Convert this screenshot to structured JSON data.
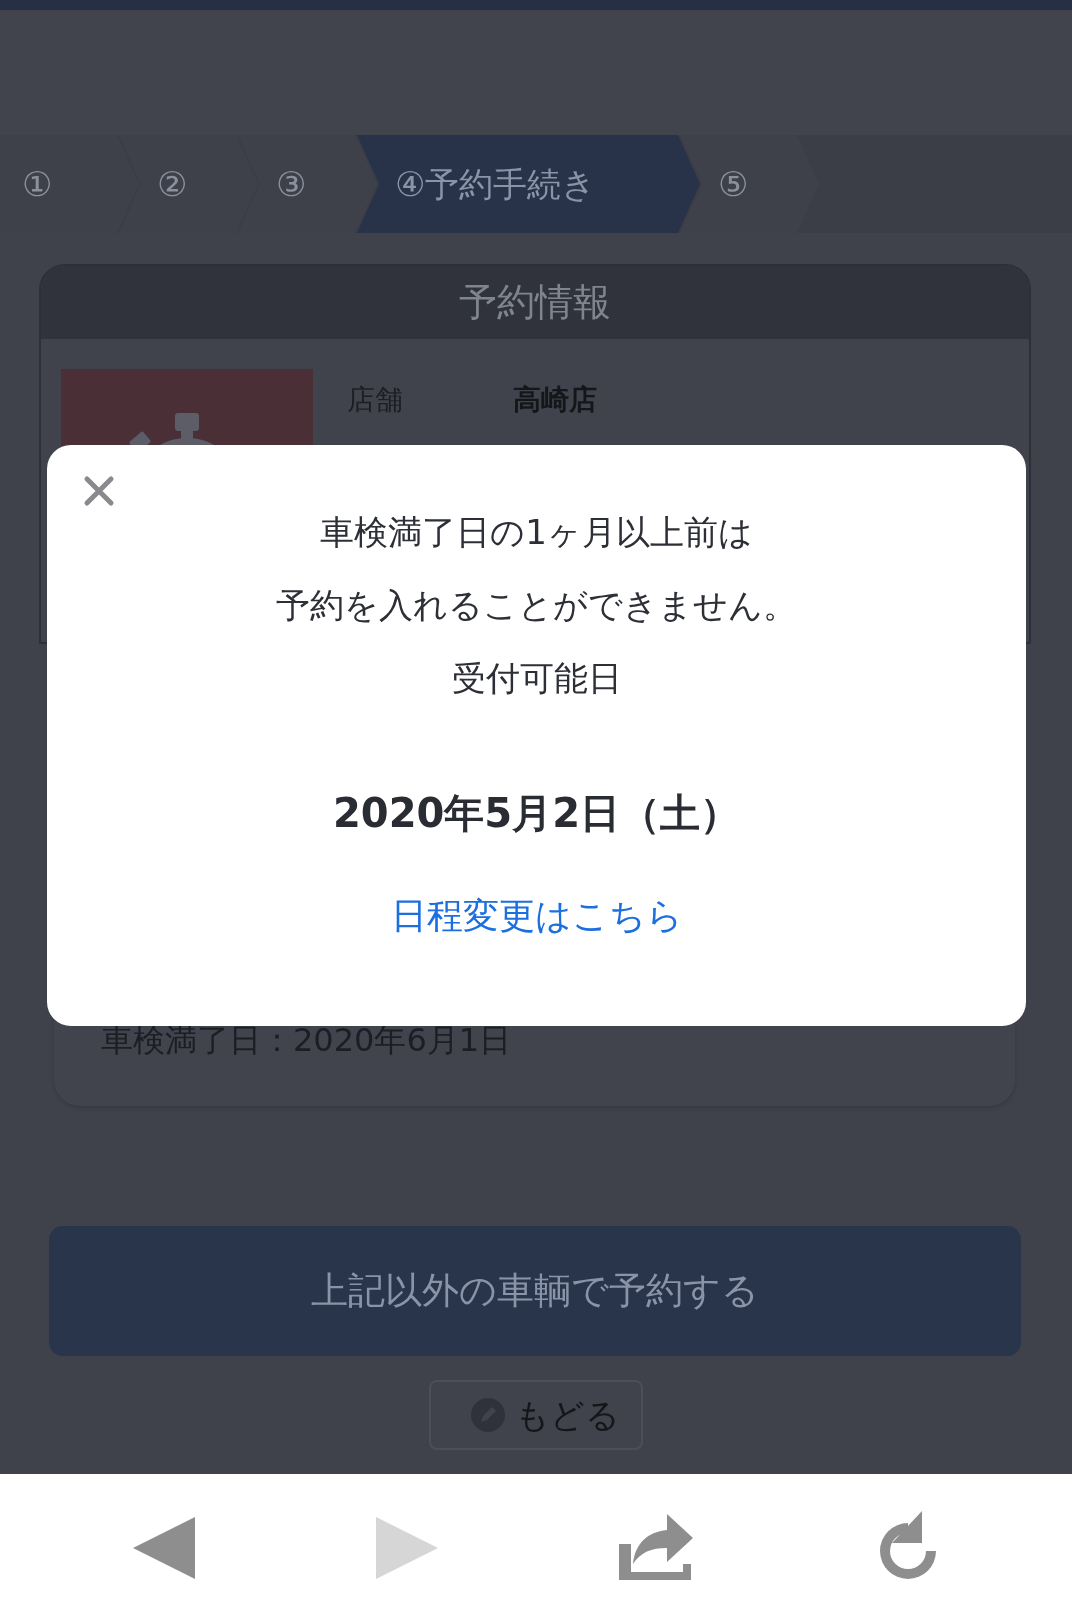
{
  "steps": [
    {
      "label": "①",
      "selected": false
    },
    {
      "label": "②",
      "selected": false
    },
    {
      "label": "③",
      "selected": false
    },
    {
      "label": "④予約手続き",
      "selected": true
    },
    {
      "label": "⑤",
      "selected": false
    }
  ],
  "reservation_card": {
    "title": "予約情報",
    "rows": [
      {
        "label": "店舗",
        "value": "高崎店"
      }
    ]
  },
  "vehicle_card": {
    "expiry_text": "車検満了日：2020年6月1日"
  },
  "other_vehicle_button": "上記以外の車輌で予約する",
  "back_button": "もどる",
  "modal": {
    "lines": [
      "車検満了日の1ヶ月以上前は",
      "予約を入れることができません。",
      "受付可能日"
    ],
    "date": "2020年5月2日（土）",
    "link": "日程変更はこちら"
  },
  "browser_toolbar": [
    {
      "kind": "back",
      "disabled": false
    },
    {
      "kind": "forward",
      "disabled": true
    },
    {
      "kind": "share",
      "disabled": false
    },
    {
      "kind": "reload",
      "disabled": false
    }
  ]
}
